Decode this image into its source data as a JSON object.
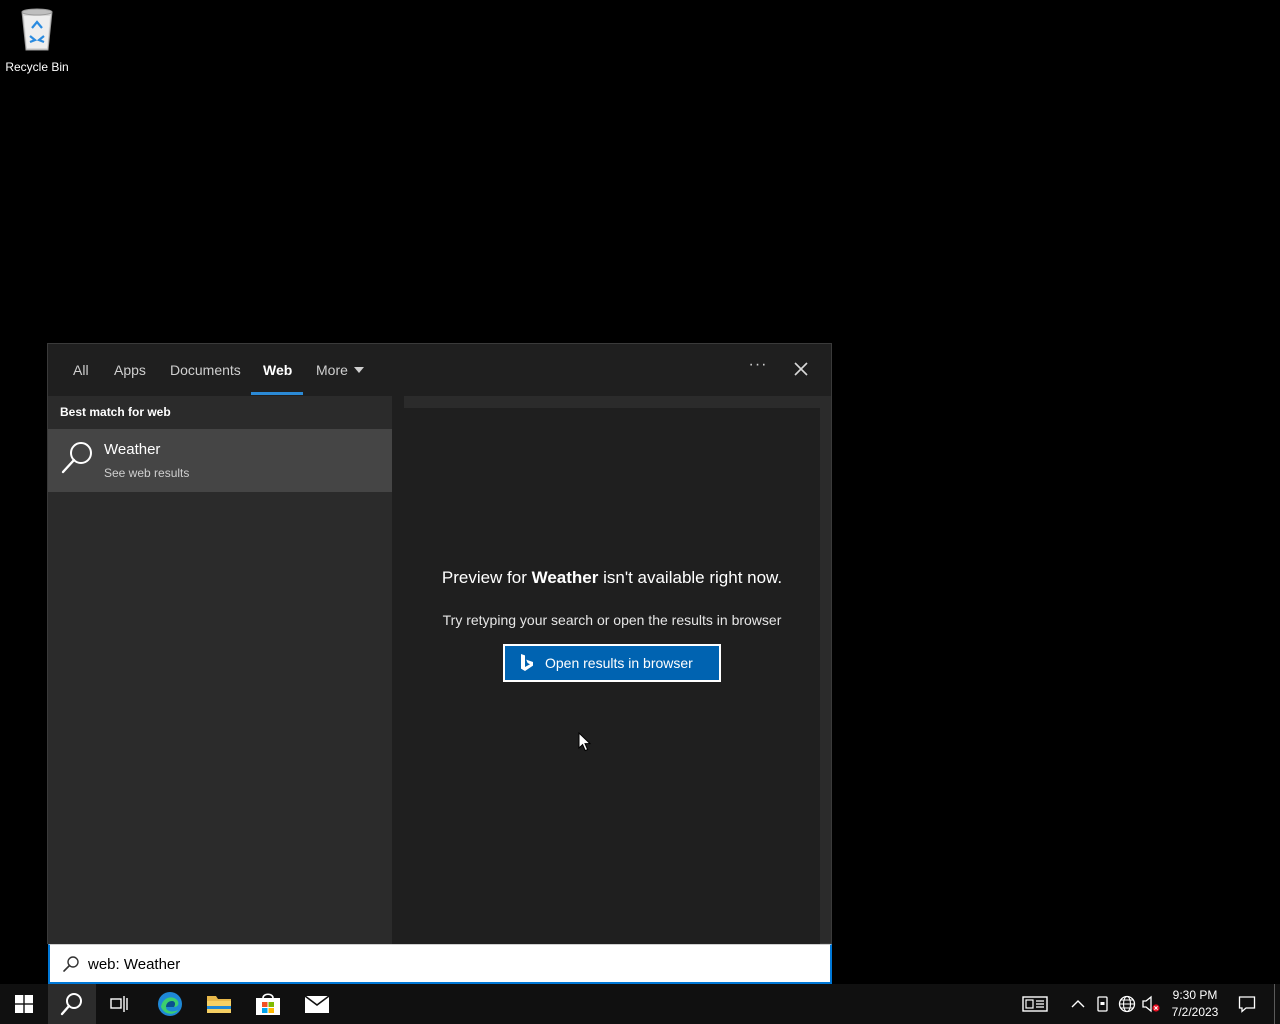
{
  "desktop": {
    "recycle_bin_label": "Recycle Bin"
  },
  "search_panel": {
    "tabs": [
      {
        "label": "All",
        "active": false
      },
      {
        "label": "Apps",
        "active": false
      },
      {
        "label": "Documents",
        "active": false
      },
      {
        "label": "Web",
        "active": true
      },
      {
        "label": "More",
        "active": false
      }
    ],
    "ellipsis_label": "···",
    "section_heading": "Best match for web",
    "result": {
      "title": "Weather",
      "subtitle": "See web results"
    },
    "preview": {
      "msg_prefix": "Preview for ",
      "msg_term": "Weather",
      "msg_suffix": " isn't available right now.",
      "hint": "Try retyping your search or open the results in browser",
      "button_label": "Open results in browser"
    },
    "search_input": {
      "value": "web: Weather"
    }
  },
  "taskbar": {
    "clock_time": "9:30 PM",
    "clock_date": "7/2/2023"
  },
  "colors": {
    "accent": "#0078d7",
    "button_blue": "#0063b1",
    "panel_bg": "#2b2b2b",
    "preview_bg": "#1f1f1f",
    "taskbar_bg": "#101010"
  }
}
